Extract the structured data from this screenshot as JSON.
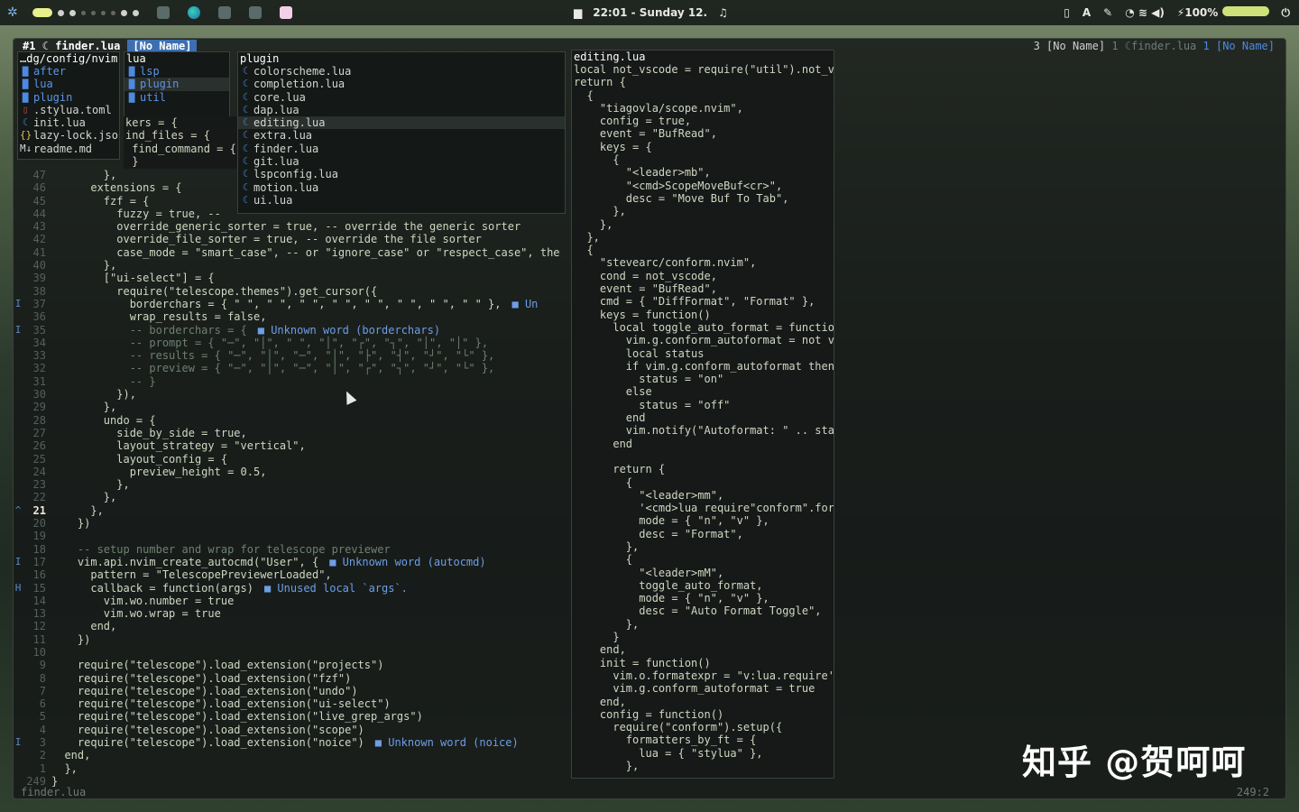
{
  "topbar": {
    "clock": "22:01 - Sunday 12.",
    "battery": "100%",
    "lang": "A"
  },
  "tabs": {
    "active_num": "#1",
    "active_name": "finder.lua",
    "noname": "[No Name]",
    "right_count": "3",
    "right_noname": "[No Name]",
    "right_dim_num": "1",
    "right_dim_file": "finder.lua",
    "right_blue_num": "1",
    "right_blue_name": "[No Name]"
  },
  "finder": {
    "col1": {
      "header": "…dg/config/nvim",
      "items": [
        {
          "icon": "folder-icon",
          "glyph": "▇",
          "label": "after",
          "type": "folder"
        },
        {
          "icon": "folder-icon",
          "glyph": "▇",
          "label": "lua",
          "type": "folder"
        },
        {
          "icon": "folder-icon",
          "glyph": "▇",
          "label": "plugin",
          "type": "folder"
        },
        {
          "icon": "toml-file-icon",
          "glyph": "▯",
          "label": ".stylua.toml",
          "type": "toml"
        },
        {
          "icon": "lua-file-icon",
          "glyph": "☾",
          "label": "init.lua",
          "type": "lua"
        },
        {
          "icon": "json-file-icon",
          "glyph": "{}",
          "label": "lazy-lock.jso",
          "type": "json"
        },
        {
          "icon": "markdown-file-icon",
          "glyph": "M↓",
          "label": "readme.md",
          "type": "md"
        }
      ]
    },
    "col2": {
      "header": "lua",
      "items": [
        {
          "icon": "folder-icon",
          "glyph": "▇",
          "label": "lsp",
          "type": "folder"
        },
        {
          "icon": "folder-icon",
          "glyph": "▇",
          "label": "plugin",
          "type": "folder",
          "selected": true
        },
        {
          "icon": "folder-icon",
          "glyph": "▇",
          "label": "util",
          "type": "folder"
        }
      ]
    },
    "col3": {
      "header": "plugin",
      "items": [
        {
          "icon": "lua-file-icon",
          "glyph": "☾",
          "label": "colorscheme.lua",
          "type": "lua"
        },
        {
          "icon": "lua-file-icon",
          "glyph": "☾",
          "label": "completion.lua",
          "type": "lua"
        },
        {
          "icon": "lua-file-icon",
          "glyph": "☾",
          "label": "core.lua",
          "type": "lua"
        },
        {
          "icon": "lua-file-icon",
          "glyph": "☾",
          "label": "dap.lua",
          "type": "lua"
        },
        {
          "icon": "lua-file-icon",
          "glyph": "☾",
          "label": "editing.lua",
          "type": "lua",
          "selected": true
        },
        {
          "icon": "lua-file-icon",
          "glyph": "☾",
          "label": "extra.lua",
          "type": "lua"
        },
        {
          "icon": "lua-file-icon",
          "glyph": "☾",
          "label": "finder.lua",
          "type": "lua"
        },
        {
          "icon": "lua-file-icon",
          "glyph": "☾",
          "label": "git.lua",
          "type": "lua"
        },
        {
          "icon": "lua-file-icon",
          "glyph": "☾",
          "label": "lspconfig.lua",
          "type": "lua"
        },
        {
          "icon": "lua-file-icon",
          "glyph": "☾",
          "label": "motion.lua",
          "type": "lua"
        },
        {
          "icon": "lua-file-icon",
          "glyph": "☾",
          "label": "ui.lua",
          "type": "lua"
        }
      ]
    },
    "peek": [
      "kers = {",
      "ind_files = {",
      " find_command = {",
      " }"
    ]
  },
  "preview": {
    "header": "editing.lua",
    "lines": [
      "local not_vscode = require(\"util\").not_v",
      "return {",
      "  {",
      "    \"tiagovla/scope.nvim\",",
      "    config = true,",
      "    event = \"BufRead\",",
      "    keys = {",
      "      {",
      "        \"<leader>mb\",",
      "        \"<cmd>ScopeMoveBuf<cr>\",",
      "        desc = \"Move Buf To Tab\",",
      "      },",
      "    },",
      "  },",
      "  {",
      "    \"stevearc/conform.nvim\",",
      "    cond = not_vscode,",
      "    event = \"BufRead\",",
      "    cmd = { \"DiffFormat\", \"Format\" },",
      "    keys = function()",
      "      local toggle_auto_format = functio",
      "        vim.g.conform_autoformat = not v",
      "        local status",
      "        if vim.g.conform_autoformat then",
      "          status = \"on\"",
      "        else",
      "          status = \"off\"",
      "        end",
      "        vim.notify(\"Autoformat: \" .. sta",
      "      end",
      "",
      "      return {",
      "        {",
      "          \"<leader>mm\",",
      "          '<cmd>lua require\"conform\".for",
      "          mode = { \"n\", \"v\" },",
      "          desc = \"Format\",",
      "        },",
      "        {",
      "          \"<leader>mM\",",
      "          toggle_auto_format,",
      "          mode = { \"n\", \"v\" },",
      "          desc = \"Auto Format Toggle\",",
      "        },",
      "      }",
      "    end,",
      "    init = function()",
      "      vim.o.formatexpr = \"v:lua.require'",
      "      vim.g.conform_autoformat = true",
      "    end,",
      "    config = function()",
      "      require(\"conform\").setup({",
      "        formatters_by_ft = {",
      "          lua = { \"stylua\" },",
      "        },"
    ]
  },
  "editor": {
    "lines": [
      {
        "sign": "",
        "num": "47",
        "code": "        },",
        "diag": ""
      },
      {
        "sign": "",
        "num": "46",
        "code": "      extensions = {",
        "diag": ""
      },
      {
        "sign": "",
        "num": "45",
        "code": "        fzf = {",
        "diag": ""
      },
      {
        "sign": "",
        "num": "44",
        "code": "          fuzzy = true, --",
        "diag": ""
      },
      {
        "sign": "",
        "num": "43",
        "code": "          override_generic_sorter = true, -- override the generic sorter",
        "diag": ""
      },
      {
        "sign": "",
        "num": "42",
        "code": "          override_file_sorter = true, -- override the file sorter",
        "diag": ""
      },
      {
        "sign": "",
        "num": "41",
        "code": "          case_mode = \"smart_case\", -- or \"ignore_case\" or \"respect_case\", the",
        "diag": ""
      },
      {
        "sign": "",
        "num": "40",
        "code": "        },",
        "diag": ""
      },
      {
        "sign": "",
        "num": "39",
        "code": "        [\"ui-select\"] = {",
        "diag": ""
      },
      {
        "sign": "",
        "num": "38",
        "code": "          require(\"telescope.themes\").get_cursor({",
        "diag": ""
      },
      {
        "sign": "I",
        "num": "37",
        "code": "            borderchars = { \" \", \" \", \" \", \" \", \" \", \" \", \" \", \" \" },",
        "diag": "■ Un"
      },
      {
        "sign": "",
        "num": "36",
        "code": "            wrap_results = false,",
        "diag": ""
      },
      {
        "sign": "I",
        "num": "35",
        "code": "            -- borderchars = {",
        "diag": "■ Unknown word (borderchars)"
      },
      {
        "sign": "",
        "num": "34",
        "code": "            -- prompt = { \"─\", \"│\", \" \", \"│\", \"┌\", \"┐\", \"│\", \"│\" },",
        "diag": ""
      },
      {
        "sign": "",
        "num": "33",
        "code": "            -- results = { \"─\", \"│\", \"─\", \"│\", \"├\", \"┤\", \"┘\", \"└\" },",
        "diag": ""
      },
      {
        "sign": "",
        "num": "32",
        "code": "            -- preview = { \"─\", \"│\", \"─\", \"│\", \"┌\", \"┐\", \"┘\", \"└\" },",
        "diag": ""
      },
      {
        "sign": "",
        "num": "31",
        "code": "            -- }",
        "diag": ""
      },
      {
        "sign": "",
        "num": "30",
        "code": "          }),",
        "diag": ""
      },
      {
        "sign": "",
        "num": "29",
        "code": "        },",
        "diag": ""
      },
      {
        "sign": "",
        "num": "28",
        "code": "        undo = {",
        "diag": ""
      },
      {
        "sign": "",
        "num": "27",
        "code": "          side_by_side = true,",
        "diag": ""
      },
      {
        "sign": "",
        "num": "26",
        "code": "          layout_strategy = \"vertical\",",
        "diag": ""
      },
      {
        "sign": "",
        "num": "25",
        "code": "          layout_config = {",
        "diag": ""
      },
      {
        "sign": "",
        "num": "24",
        "code": "            preview_height = 0.5,",
        "diag": ""
      },
      {
        "sign": "",
        "num": "23",
        "code": "          },",
        "diag": ""
      },
      {
        "sign": "",
        "num": "22",
        "code": "        },",
        "diag": ""
      },
      {
        "sign": "^",
        "num": "21",
        "code": "      },",
        "diag": "",
        "current": true
      },
      {
        "sign": "",
        "num": "20",
        "code": "    })",
        "diag": ""
      },
      {
        "sign": "",
        "num": "19",
        "code": "",
        "diag": ""
      },
      {
        "sign": "",
        "num": "18",
        "code": "    -- setup number and wrap for telescope previewer",
        "diag": ""
      },
      {
        "sign": "I",
        "num": "17",
        "code": "    vim.api.nvim_create_autocmd(\"User\", {",
        "diag": "■ Unknown word (autocmd)"
      },
      {
        "sign": "",
        "num": "16",
        "code": "      pattern = \"TelescopePreviewerLoaded\",",
        "diag": ""
      },
      {
        "sign": "H",
        "num": "15",
        "code": "      callback = function(args)",
        "diag": "■ Unused local `args`."
      },
      {
        "sign": "",
        "num": "14",
        "code": "        vim.wo.number = true",
        "diag": ""
      },
      {
        "sign": "",
        "num": "13",
        "code": "        vim.wo.wrap = true",
        "diag": ""
      },
      {
        "sign": "",
        "num": "12",
        "code": "      end,",
        "diag": ""
      },
      {
        "sign": "",
        "num": "11",
        "code": "    })",
        "diag": ""
      },
      {
        "sign": "",
        "num": "10",
        "code": "",
        "diag": ""
      },
      {
        "sign": "",
        "num": "9",
        "code": "    require(\"telescope\").load_extension(\"projects\")",
        "diag": ""
      },
      {
        "sign": "",
        "num": "8",
        "code": "    require(\"telescope\").load_extension(\"fzf\")",
        "diag": ""
      },
      {
        "sign": "",
        "num": "7",
        "code": "    require(\"telescope\").load_extension(\"undo\")",
        "diag": ""
      },
      {
        "sign": "",
        "num": "6",
        "code": "    require(\"telescope\").load_extension(\"ui-select\")",
        "diag": ""
      },
      {
        "sign": "",
        "num": "5",
        "code": "    require(\"telescope\").load_extension(\"live_grep_args\")",
        "diag": ""
      },
      {
        "sign": "",
        "num": "4",
        "code": "    require(\"telescope\").load_extension(\"scope\")",
        "diag": ""
      },
      {
        "sign": "I",
        "num": "3",
        "code": "    require(\"telescope\").load_extension(\"noice\")",
        "diag": "■ Unknown word (noice)"
      },
      {
        "sign": "",
        "num": "2",
        "code": "  end,",
        "diag": ""
      },
      {
        "sign": "",
        "num": "1",
        "code": "  },",
        "diag": ""
      },
      {
        "sign": "",
        "num": "249",
        "code": "}",
        "diag": ""
      }
    ]
  },
  "status": {
    "file": "finder.lua",
    "position": "249:2"
  },
  "watermark": "知乎 @贺呵呵",
  "colors": {
    "accent_blue": "#3d6fb0",
    "diagnostic": "#6d9ee6",
    "folder": "#5d95e6",
    "workspace_active": "#e7f08b"
  }
}
